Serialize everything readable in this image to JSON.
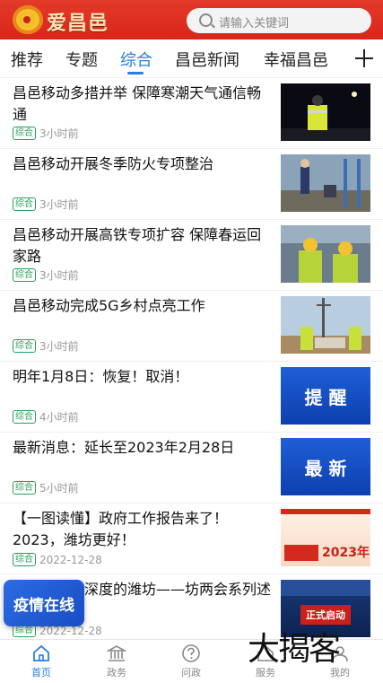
{
  "header": {
    "brand": "爱昌邑",
    "search_placeholder": "请输入关键词"
  },
  "tabs": [
    "推荐",
    "专题",
    "综合",
    "昌邑新闻",
    "幸福昌邑"
  ],
  "active_tab": 2,
  "items": [
    {
      "title": "昌邑移动多措并举  保障寒潮天气通信畅通",
      "tag": "综合",
      "time": "3小时前"
    },
    {
      "title": "昌邑移动开展冬季防火专项整治",
      "tag": "综合",
      "time": "3小时前"
    },
    {
      "title": "昌邑移动开展高铁专项扩容  保障春运回家路",
      "tag": "综合",
      "time": "3小时前"
    },
    {
      "title": "昌邑移动完成5G乡村点亮工作",
      "tag": "综合",
      "time": "3小时前"
    },
    {
      "title": "明年1月8日：恢复！取消！",
      "tag": "综合",
      "time": "4小时前",
      "thumb_text": "提 醒"
    },
    {
      "title": "最新消息：延长至2023年2月28日",
      "tag": "综合",
      "time": "5小时前",
      "thumb_text": "最 新"
    },
    {
      "title": "【一图读懂】政府工作报告来了！2023，潍坊更好！",
      "tag": "综合",
      "time": "2022-12-28",
      "thumb_text": "2023年"
    },
    {
      "title": "度、温度、深度的潍坊——坊两会系列述评之一",
      "tag": "综合",
      "time": "2022-12-28",
      "thumb_text": "正式启动"
    }
  ],
  "float_card": "疫情在线",
  "watermark": "大揭客",
  "bottom_nav": [
    {
      "label": "首页",
      "icon": "home-icon"
    },
    {
      "label": "政务",
      "icon": "government-icon"
    },
    {
      "label": "问政",
      "icon": "question-icon"
    },
    {
      "label": "服务",
      "icon": "service-icon"
    },
    {
      "label": "我的",
      "icon": "profile-icon"
    }
  ],
  "colors": {
    "header_red": "#d9261a",
    "accent_blue": "#2a7de1",
    "tag_green": "#2a9d5c"
  }
}
